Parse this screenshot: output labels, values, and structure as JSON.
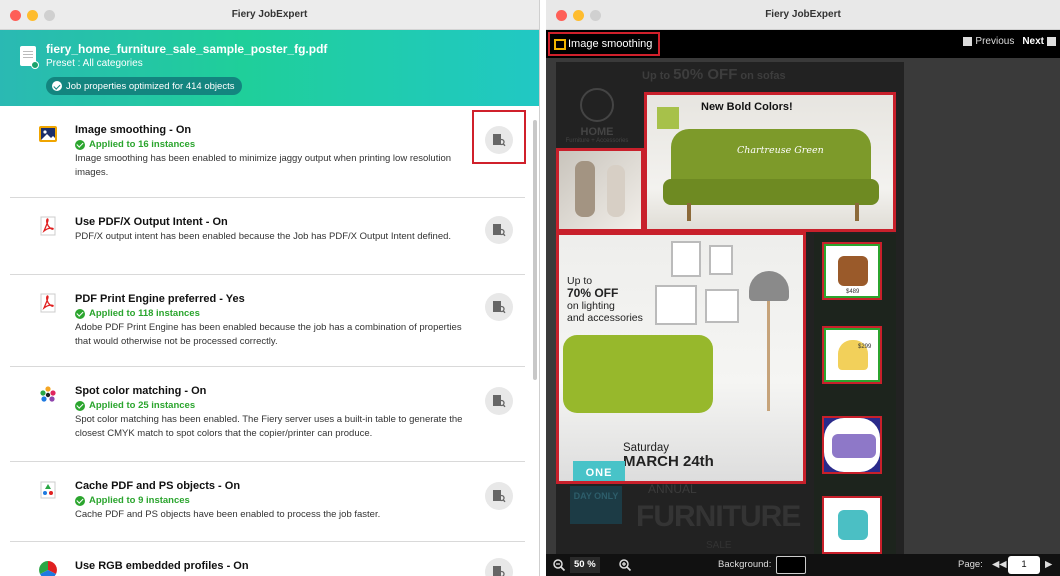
{
  "left_window": {
    "title": "Fiery JobExpert",
    "filename": "fiery_home_furniture_sale_sample_poster_fg.pdf",
    "preset": "Preset : All categories",
    "optimized": "Job properties optimized for 414 objects",
    "items": [
      {
        "title": "Image smoothing - On",
        "applied": "Applied to 16 instances",
        "desc": "Image smoothing has been enabled to minimize jaggy output when printing low resolution images.",
        "icon": "image-icon"
      },
      {
        "title": "Use PDF/X Output Intent - On",
        "applied": "",
        "desc": "PDF/X output intent has been enabled because the Job has PDF/X Output Intent defined.",
        "icon": "pdf-icon"
      },
      {
        "title": "PDF Print Engine preferred - Yes",
        "applied": "Applied to 118 instances",
        "desc": "Adobe PDF Print Engine has been enabled because the job has a combination of properties that would otherwise not be processed correctly.",
        "icon": "pdf-icon"
      },
      {
        "title": "Spot color matching - On",
        "applied": "Applied to 25 instances",
        "desc": "Spot color matching has been enabled. The Fiery server uses a built-in table to generate the closest CMYK match to spot colors that the copier/printer can produce.",
        "icon": "spot-color-icon"
      },
      {
        "title": "Cache PDF and PS objects - On",
        "applied": "Applied to 9 instances",
        "desc": "Cache PDF and PS objects have been enabled to process the job faster.",
        "icon": "cache-icon"
      },
      {
        "title": "Use RGB embedded profiles - On",
        "applied": "",
        "desc": "",
        "icon": "rgb-profile-icon"
      }
    ]
  },
  "right_window": {
    "title": "Fiery JobExpert",
    "feature_label": "Image smoothing",
    "previous": "Previous",
    "next": "Next",
    "poster": {
      "banner_pre": "Up to ",
      "banner_big": "50% OFF",
      "banner_post": " on sofas",
      "home": "HOME",
      "home_sub": "Furniture + Accessories",
      "new_colors": "New Bold Colors!",
      "color_name": "Chartreuse Green",
      "upto": "Up to",
      "off70": "70% OFF",
      "lighting1": "on lighting",
      "lighting2": "and accessories",
      "saturday": "Saturday",
      "date": "MARCH 24th",
      "one": "ONE",
      "oneday": "DAY ONLY",
      "annual": "ANNUAL",
      "furniture": "FURNITURE",
      "sale": "SALE",
      "prices": [
        "$489",
        "$299",
        "",
        ""
      ]
    },
    "zoom": "50 %",
    "background_label": "Background:",
    "page_label": "Page:",
    "page_value": "1"
  },
  "colors": {
    "accent_teal": "#1fcf9a",
    "highlight_red": "#d0202b",
    "applied_green": "#2ba52e"
  }
}
